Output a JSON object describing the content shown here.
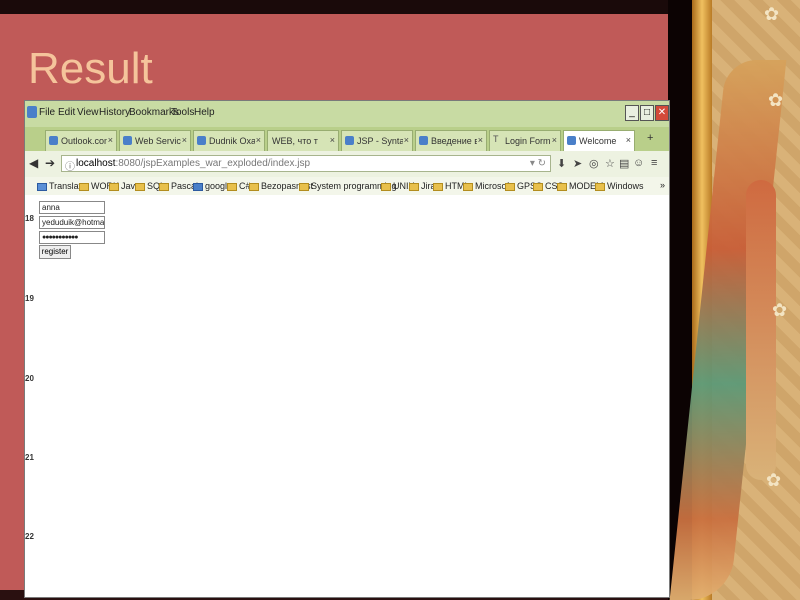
{
  "slide": {
    "title": "Result"
  },
  "browser": {
    "menu": [
      "File",
      "Edit",
      "View",
      "History",
      "Bookmarks",
      "Tools",
      "Help"
    ],
    "tabs": [
      {
        "label": "Outlook.com ..."
      },
      {
        "label": "Web Services..."
      },
      {
        "label": "Dudnik Oxan..."
      },
      {
        "label": "WEB, что такое..."
      },
      {
        "label": "JSP - Syntax..."
      },
      {
        "label": "Введение в J..."
      },
      {
        "label": "Login Form (..."
      },
      {
        "label": "Welcome",
        "active": true
      }
    ],
    "url": {
      "host": "localhost",
      "rest": ":8080/jspExamples_war_exploded/index.jsp"
    },
    "bookmarks": [
      "Translate",
      "WORK",
      "Java",
      "SQL",
      "Pascal",
      "google",
      "C#",
      "Bezopasnost",
      "System programming",
      "UNIX",
      "Jira",
      "HTML",
      "Microsoft",
      "GPSS",
      "CSS",
      "MODEM",
      "Windows"
    ]
  },
  "form": {
    "name_value": "anna",
    "email_value": "yeduduik@hotmail.com",
    "password_value": "●●●●●●●●●●●",
    "register_label": "register"
  },
  "page_numbers": [
    "18",
    "19",
    "20",
    "21",
    "22"
  ]
}
